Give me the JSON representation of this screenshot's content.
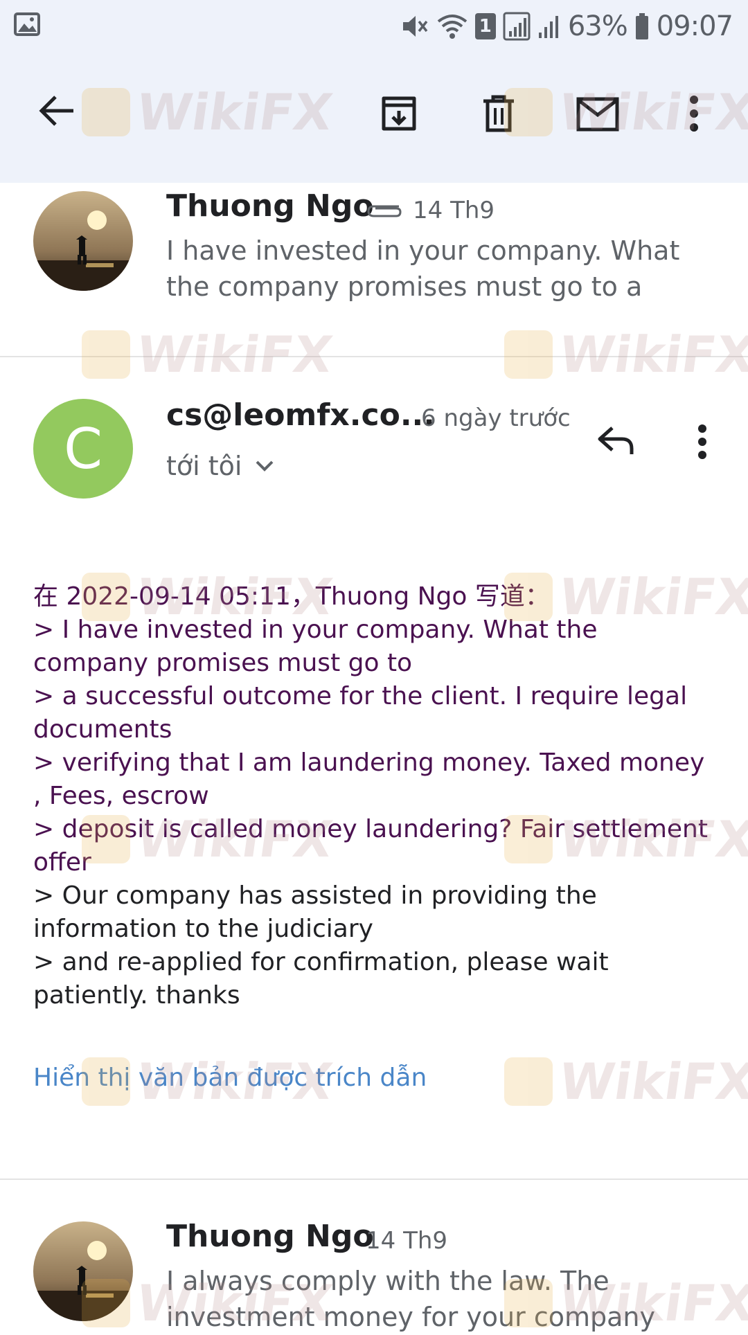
{
  "status_bar": {
    "battery": "63%",
    "time": "09:07",
    "sim_badge": "1",
    "icons": [
      "gallery-icon",
      "mute-icon",
      "wifi-icon",
      "sim-icon",
      "signal-icon",
      "signal2-icon",
      "battery-icon"
    ]
  },
  "toolbar": {
    "icons": [
      "back-arrow-icon",
      "archive-icon",
      "trash-icon",
      "mark-unread-icon",
      "more-vert-icon"
    ]
  },
  "emails": [
    {
      "sender": "Thuong Ngo",
      "date": "14 Th9",
      "has_attachment": true,
      "snippet": "I have invested in your company. What the company promises must go to a"
    },
    {
      "sender": "cs@leomfx.co...",
      "avatar_letter": "C",
      "date": "6 ngày trước",
      "recipient": "tới tôi",
      "body_quoted": [
        "在 2022-09-14 05:11，Thuong Ngo 写道：",
        "> I have invested in your company. What the company promises must go to",
        "> a successful outcome for the client. I require legal documents",
        "> verifying that I am laundering money. Taxed money , Fees, escrow",
        "> deposit is called money laundering? Fair settlement offer"
      ],
      "body_reply": [
        "> Our company has assisted in providing the information to the judiciary",
        "> and re-applied for confirmation, please wait patiently. thanks"
      ],
      "show_quoted_text": "Hiển thị văn bản được trích dẫn"
    },
    {
      "sender": "Thuong Ngo",
      "date": "14 Th9",
      "snippet": "I always comply with the law. The investment money for your company"
    }
  ],
  "watermark": "WikiFX",
  "colors": {
    "header_bg": "#eef2fa",
    "avatar_green": "#93c95e",
    "quoted_text": "#4a1150",
    "link": "#4a86c8"
  }
}
